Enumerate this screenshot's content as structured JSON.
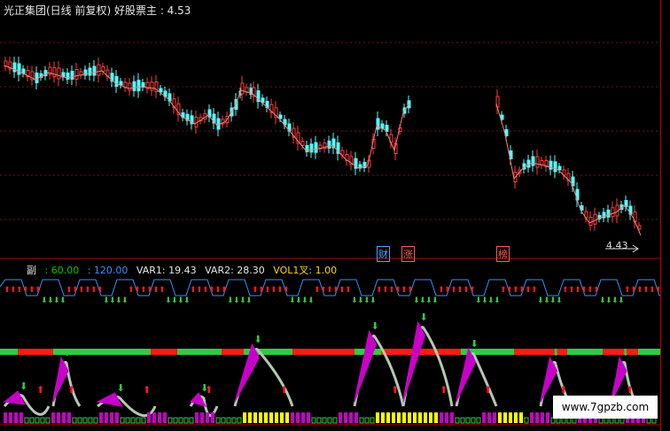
{
  "main": {
    "title": "光正集团(日线 前复权) 好股票主",
    "title_value": ": 4.53",
    "last_price": "4.43",
    "markers": [
      {
        "text": "财",
        "color": "#4aa3ff"
      },
      {
        "text": "涨",
        "color": "#ff5a5a"
      },
      {
        "text": "榜",
        "color": "#ff5a5a"
      }
    ]
  },
  "sub": {
    "label": "副",
    "items": [
      {
        "text": ": 60.00",
        "color": "#00c800"
      },
      {
        "text": ": 120.00",
        "color": "#3c8cff"
      },
      {
        "text": "VAR1: 19.43",
        "color": "#e6e6e6"
      },
      {
        "text": "VAR2: 28.30",
        "color": "#e6e6e6"
      },
      {
        "text": "VOL1叉: 1.00",
        "color": "#ffd700"
      }
    ]
  },
  "watermark": "www.7gpzb.com",
  "colors": {
    "up": "#ff3b3b",
    "down": "#54ffff",
    "band": "#2ecc40",
    "band_red": "#ff1a1a",
    "purple": "#c800c8",
    "grey": "#b4c8b4",
    "yellow": "#ffff00",
    "axis": "#b40000"
  }
}
